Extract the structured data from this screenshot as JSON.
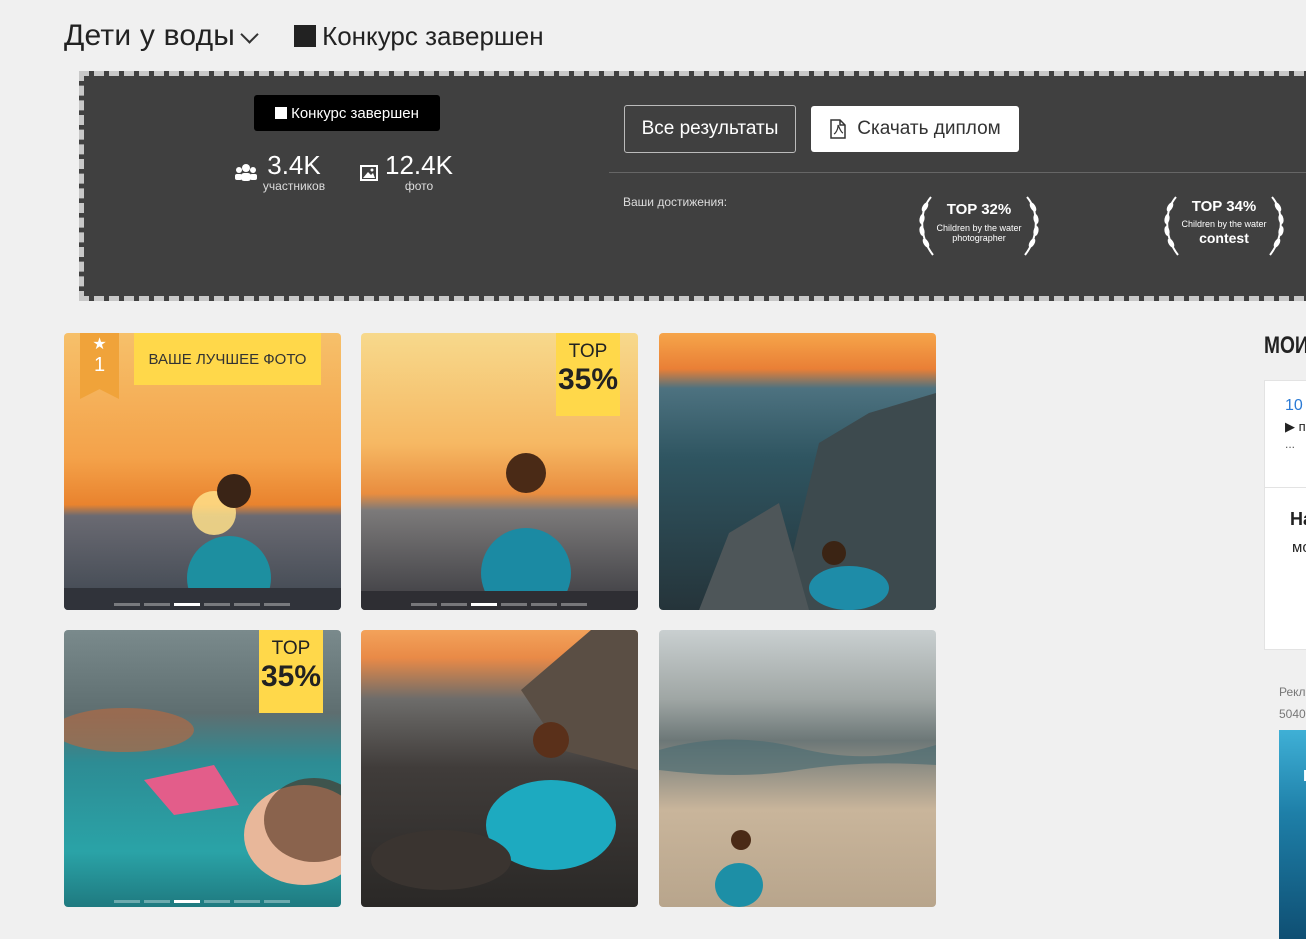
{
  "header": {
    "title": "Дети у воды",
    "status": "Конкурс завершен"
  },
  "panel": {
    "status_badge": "Конкурс завершен",
    "participants_value": "3.4K",
    "participants_label": "участников",
    "photos_value": "12.4K",
    "photos_label": "фото",
    "all_results_button": "Все результаты",
    "download_button": "Скачать диплом",
    "achievements_label": "Ваши достижения:",
    "awards": [
      {
        "top": "TOP 32%",
        "line1": "Children by the water",
        "line2": "photographer"
      },
      {
        "top": "TOP 34%",
        "line1": "Children by the water",
        "line2": "contest"
      }
    ]
  },
  "photos": {
    "best_label": "ВАШЕ ЛУЧШЕЕ ФОТО",
    "best_rank": "1",
    "top_word": "TOP",
    "top_percent": "35%"
  },
  "sidebar": {
    "title": "МОИ",
    "item_link": "10",
    "item_text": "▶ п",
    "item_more": "...",
    "section_title": "На",
    "section_text": "мо",
    "ad_line1": "Рекл",
    "ad_line2": "5040",
    "ad_banner_text": "П"
  },
  "colors": {
    "panel_bg": "#404040",
    "tag_yellow": "#ffd84a",
    "ribbon_orange": "#f0a33a",
    "link_blue": "#2a7ad5"
  }
}
